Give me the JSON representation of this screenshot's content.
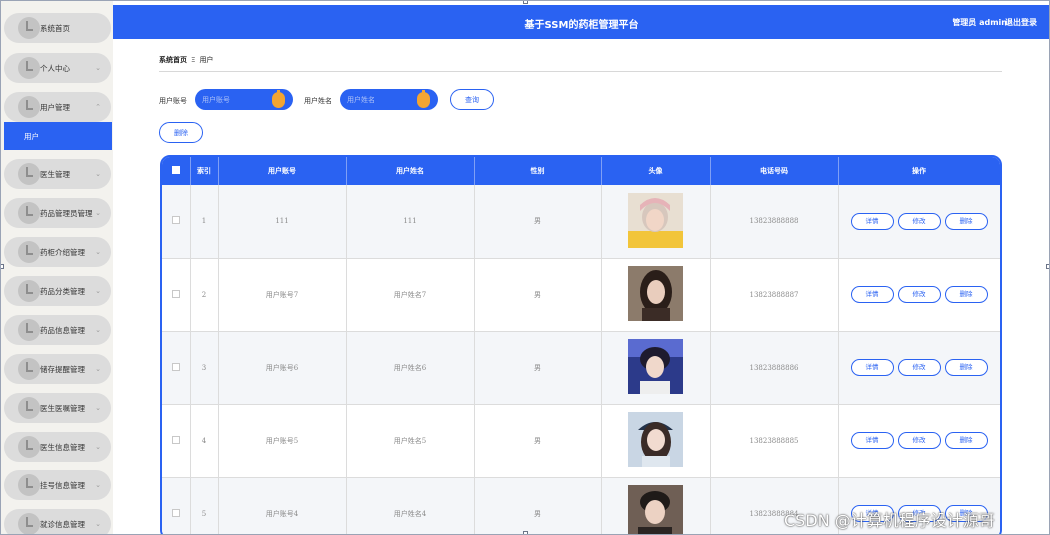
{
  "app": {
    "title": "基于SSM的药柜管理平台",
    "user": "管理员 admin",
    "logout": "退出登录"
  },
  "sidebar": {
    "items": [
      {
        "label": "系统首页",
        "chevron": false
      },
      {
        "label": "个人中心",
        "chevron": true
      },
      {
        "label": "用户管理",
        "chevron": true,
        "expanded": true
      },
      {
        "label": "医生管理",
        "chevron": true
      },
      {
        "label": "药品管理员管理",
        "chevron": true
      },
      {
        "label": "药柜介绍管理",
        "chevron": true
      },
      {
        "label": "药品分类管理",
        "chevron": true
      },
      {
        "label": "药品信息管理",
        "chevron": true
      },
      {
        "label": "储存提醒管理",
        "chevron": true
      },
      {
        "label": "医生医嘱管理",
        "chevron": true
      },
      {
        "label": "医生信息管理",
        "chevron": true
      },
      {
        "label": "挂号信息管理",
        "chevron": true
      },
      {
        "label": "就诊信息管理",
        "chevron": true
      }
    ],
    "active_sub": "用户"
  },
  "breadcrumb": {
    "home": "系统首页",
    "separator": "Ξ",
    "current": "用户"
  },
  "search": {
    "account_label": "用户账号",
    "account_placeholder": "用户账号",
    "name_label": "用户姓名",
    "name_placeholder": "用户姓名",
    "query_button": "查询"
  },
  "actions": {
    "delete_button": "删除"
  },
  "table": {
    "headers": [
      "",
      "索引",
      "用户账号",
      "用户姓名",
      "性别",
      "头像",
      "电话号码",
      "操作"
    ],
    "rows": [
      {
        "index": "1",
        "account": "111",
        "name": "111",
        "gender": "男",
        "phone": "13823888888",
        "avatar": "avatar-1"
      },
      {
        "index": "2",
        "account": "用户账号7",
        "name": "用户姓名7",
        "gender": "男",
        "phone": "13823888887",
        "avatar": "avatar-2"
      },
      {
        "index": "3",
        "account": "用户账号6",
        "name": "用户姓名6",
        "gender": "男",
        "phone": "13823888886",
        "avatar": "avatar-3"
      },
      {
        "index": "4",
        "account": "用户账号5",
        "name": "用户姓名5",
        "gender": "男",
        "phone": "13823888885",
        "avatar": "avatar-4"
      },
      {
        "index": "5",
        "account": "用户账号4",
        "name": "用户姓名4",
        "gender": "男",
        "phone": "13823888884",
        "avatar": "avatar-5"
      }
    ],
    "row_actions": {
      "detail": "详情",
      "edit": "修改",
      "delete": "删除"
    }
  },
  "watermark": "CSDN @计算机程序设计源哥",
  "colors": {
    "primary": "#2a62f2",
    "accent": "#f3a532",
    "sidebar_bg": "#f3f2ee"
  }
}
